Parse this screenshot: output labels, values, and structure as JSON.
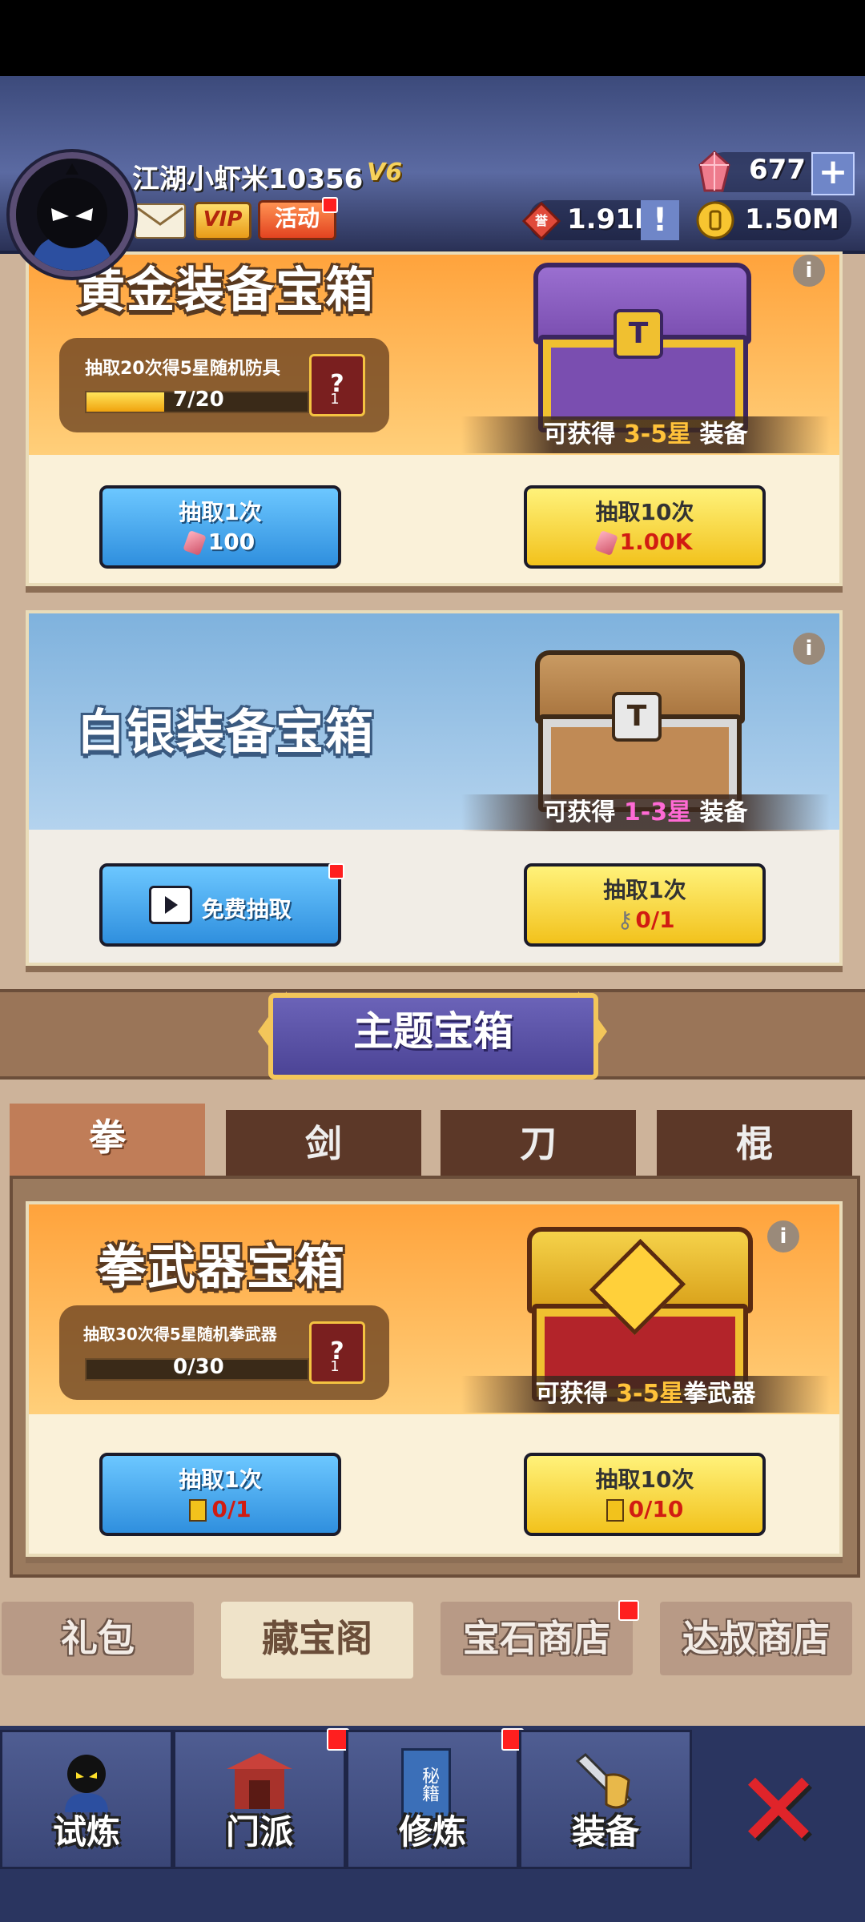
{
  "header": {
    "username": "江湖小虾米10356",
    "vip_level": "V6",
    "vip_label": "VIP",
    "activity_label": "活动",
    "gems": "677",
    "tokens": "1.91K",
    "coins": "1.50M",
    "honor_icon_text": "誉"
  },
  "gold_chest": {
    "title": "黄金装备宝箱",
    "progress_text": "抽取20次得5星随机防具",
    "progress_value": "7/20",
    "progress_fraction": 0.35,
    "reward_text_prefix": "可获得",
    "reward_range": "3-5星",
    "reward_suffix": "装备",
    "draw1_label": "抽取1次",
    "draw1_cost": "100",
    "draw10_label": "抽取10次",
    "draw10_cost": "1.00K",
    "card_count": "1"
  },
  "silver_chest": {
    "title": "白银装备宝箱",
    "reward_text_prefix": "可获得",
    "reward_range": "1-3星",
    "reward_suffix": "装备",
    "free_label": "免费抽取",
    "draw1_label": "抽取1次",
    "draw1_cost": "0/1"
  },
  "theme": {
    "banner": "主题宝箱",
    "tabs": [
      "拳",
      "剑",
      "刀",
      "棍"
    ]
  },
  "fist_chest": {
    "title": "拳武器宝箱",
    "progress_text": "抽取30次得5星随机拳武器",
    "progress_value": "0/30",
    "progress_fraction": 0,
    "reward_text_prefix": "可获得",
    "reward_range": "3-5星",
    "reward_suffix": "拳武器",
    "draw1_label": "抽取1次",
    "draw1_cost": "0/1",
    "draw10_label": "抽取10次",
    "draw10_cost": "0/10",
    "card_count": "1"
  },
  "shop_tabs": [
    "礼包",
    "藏宝阁",
    "宝石商店",
    "达叔商店"
  ],
  "nav": {
    "items": [
      "试炼",
      "门派",
      "修炼",
      "装备"
    ],
    "book_text": "秘籍"
  },
  "colors": {
    "accent_gold": "#f2c21c",
    "accent_blue": "#2f8fde",
    "badge_red": "#ff1f1f"
  }
}
